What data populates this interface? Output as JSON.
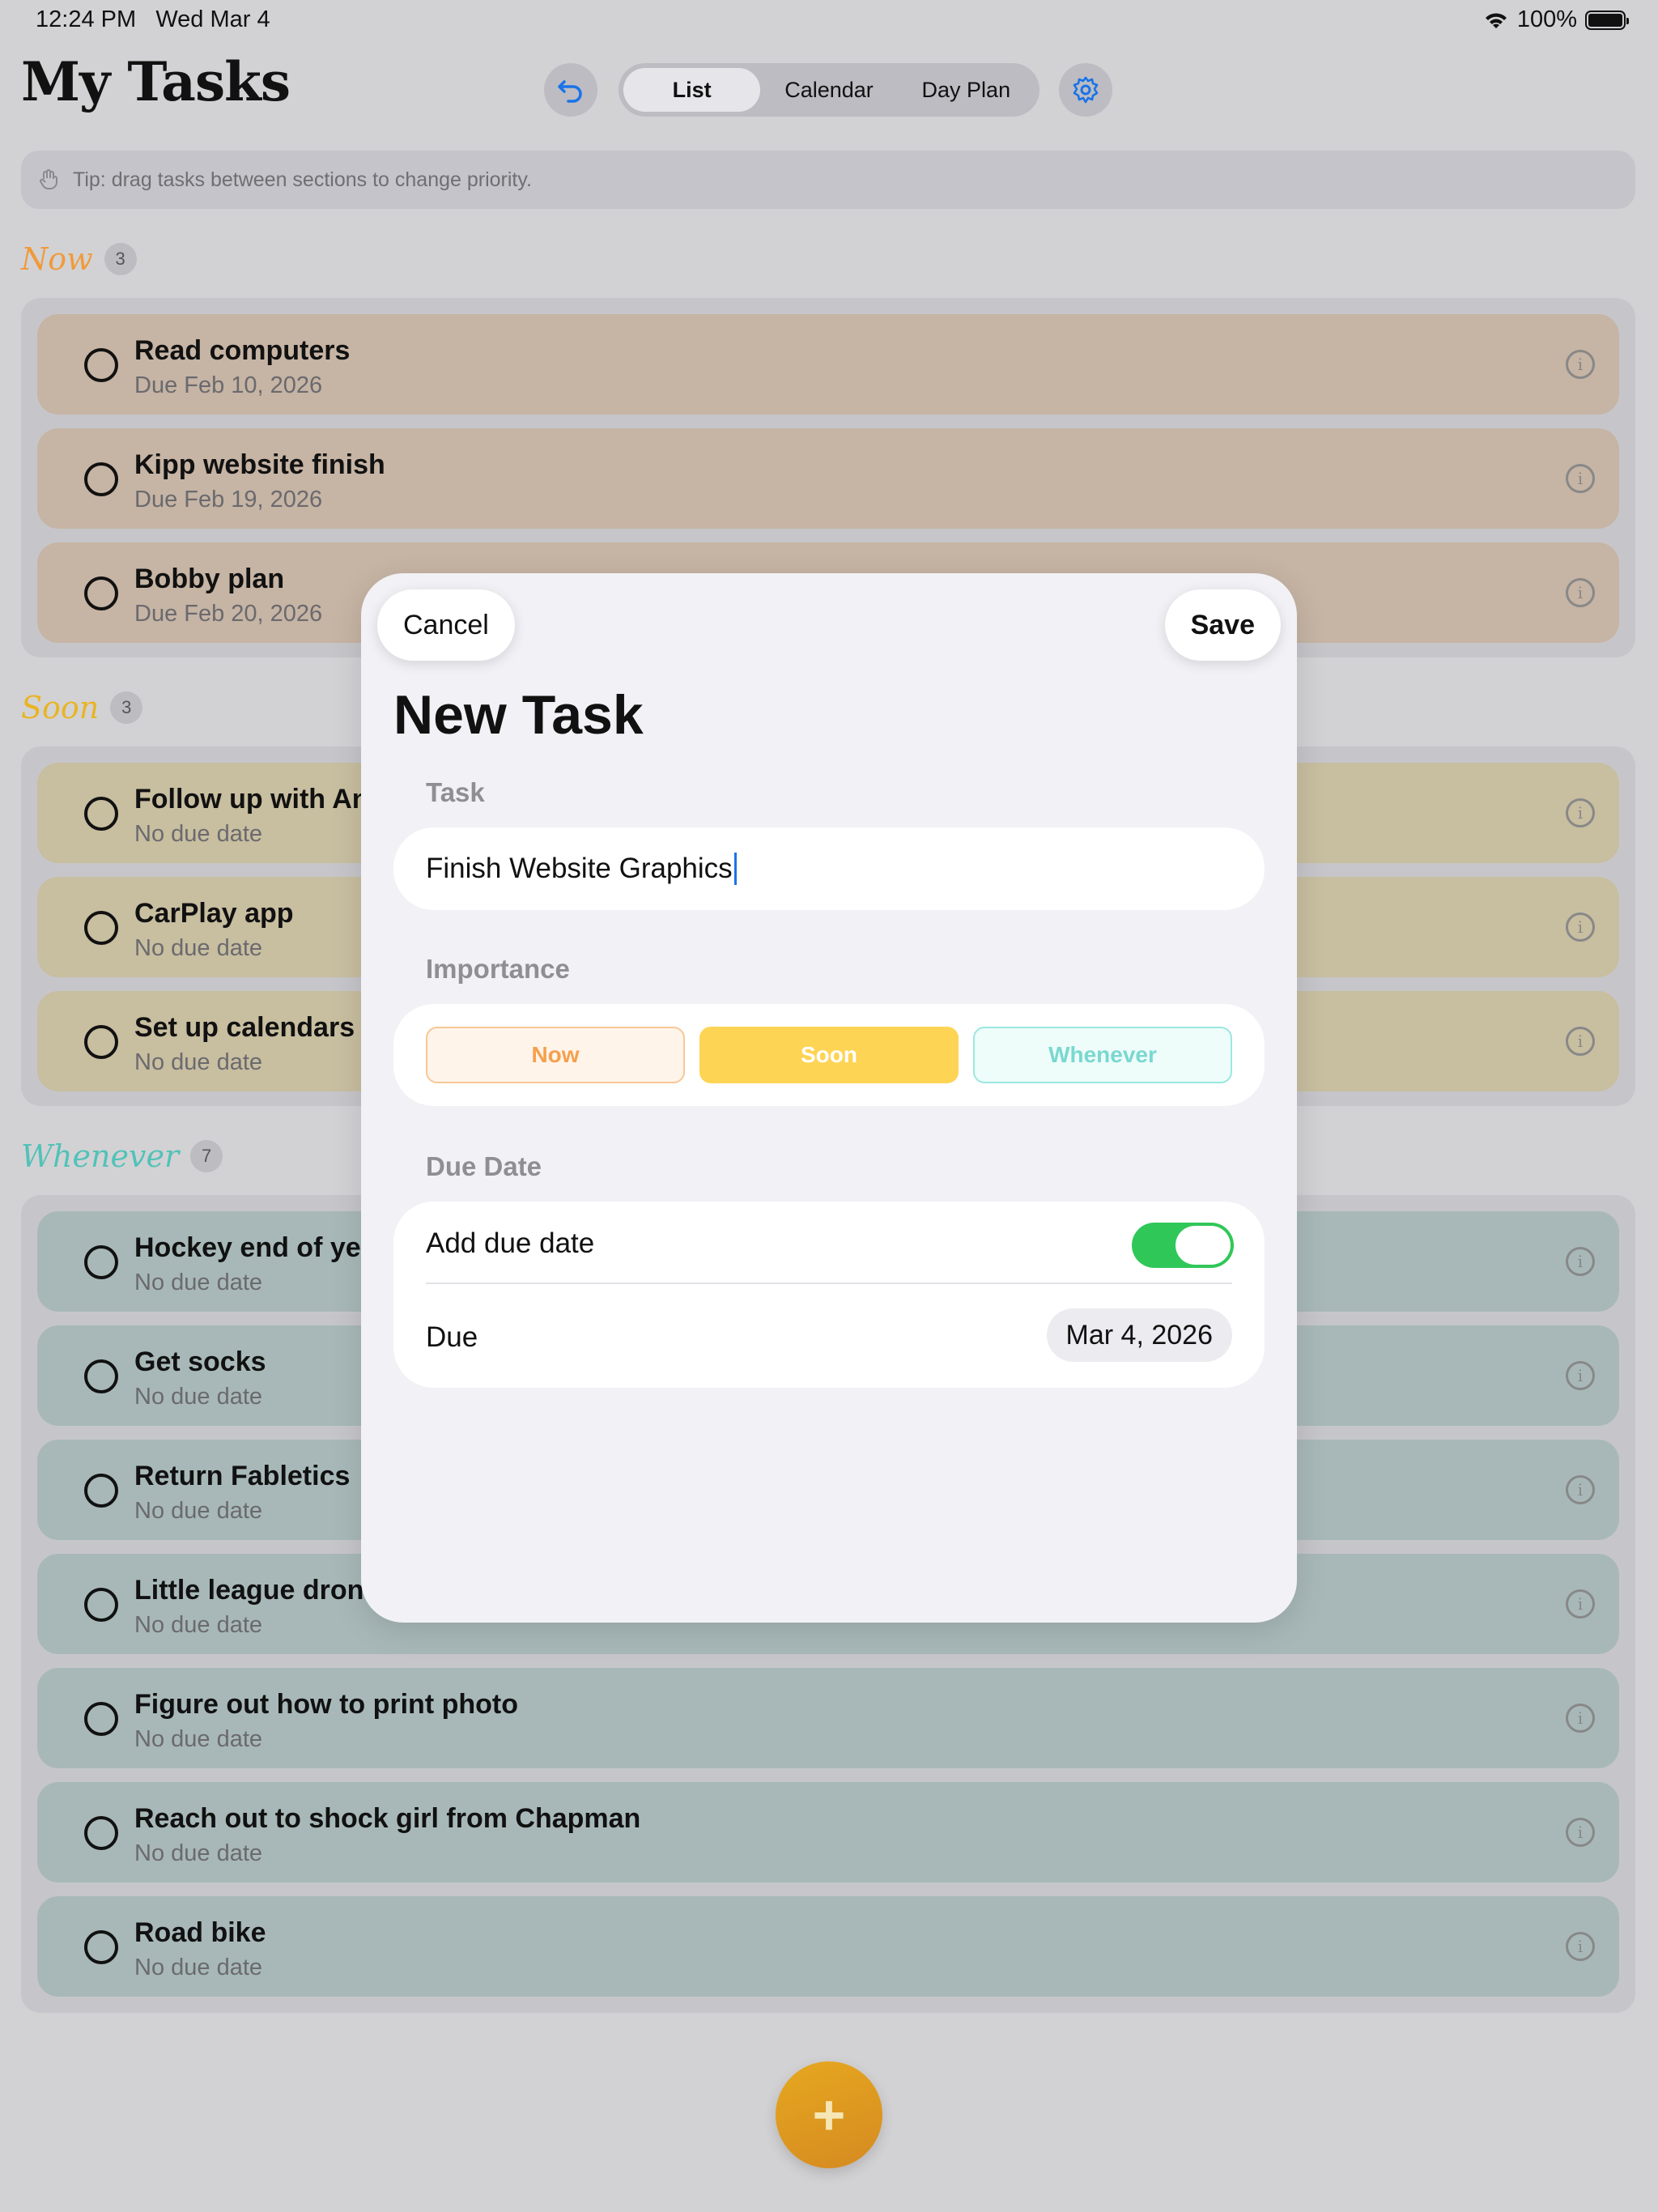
{
  "status": {
    "time": "12:24 PM",
    "date": "Wed Mar 4",
    "battery": "100%"
  },
  "header": {
    "title": "My Tasks",
    "tabs": [
      {
        "label": "List",
        "active": true
      },
      {
        "label": "Calendar",
        "active": false
      },
      {
        "label": "Day Plan",
        "active": false
      }
    ]
  },
  "tip": "Tip: drag tasks between sections to change priority.",
  "sections": {
    "now": {
      "title": "Now",
      "count": "3",
      "tasks": [
        {
          "title": "Read computers",
          "sub": "Due Feb 10, 2026"
        },
        {
          "title": "Kipp website finish",
          "sub": "Due Feb 19, 2026"
        },
        {
          "title": "Bobby plan",
          "sub": "Due Feb 20, 2026"
        }
      ]
    },
    "soon": {
      "title": "Soon",
      "count": "3",
      "tasks": [
        {
          "title": "Follow up with An",
          "sub": "No due date"
        },
        {
          "title": "CarPlay app",
          "sub": "No due date"
        },
        {
          "title": "Set up calendars i",
          "sub": "No due date"
        }
      ]
    },
    "whenever": {
      "title": "Whenever",
      "count": "7",
      "tasks": [
        {
          "title": "Hockey end of yea",
          "sub": "No due date"
        },
        {
          "title": "Get socks",
          "sub": "No due date"
        },
        {
          "title": "Return Fabletics",
          "sub": "No due date"
        },
        {
          "title": "Little league dron",
          "sub": "No due date"
        },
        {
          "title": "Figure out how to print photo",
          "sub": "No due date"
        },
        {
          "title": "Reach out to shock girl from Chapman",
          "sub": "No due date"
        },
        {
          "title": "Road bike",
          "sub": "No due date"
        }
      ]
    }
  },
  "fab": {
    "symbol": "+"
  },
  "modal": {
    "cancel": "Cancel",
    "save": "Save",
    "title": "New Task",
    "task_label": "Task",
    "task_value": "Finish Website Graphics",
    "importance_label": "Importance",
    "importance": [
      {
        "label": "Now"
      },
      {
        "label": "Soon",
        "selected": true
      },
      {
        "label": "Whenever"
      }
    ],
    "due_label": "Due Date",
    "add_due_label": "Add due date",
    "add_due_on": true,
    "due_row_label": "Due",
    "due_value": "Mar 4, 2026"
  },
  "colors": {
    "now": "#f09a3c",
    "soon": "#e9b422",
    "whenever": "#52c2b8",
    "toggle_on": "#30c759",
    "accent": "#1a73e8"
  }
}
